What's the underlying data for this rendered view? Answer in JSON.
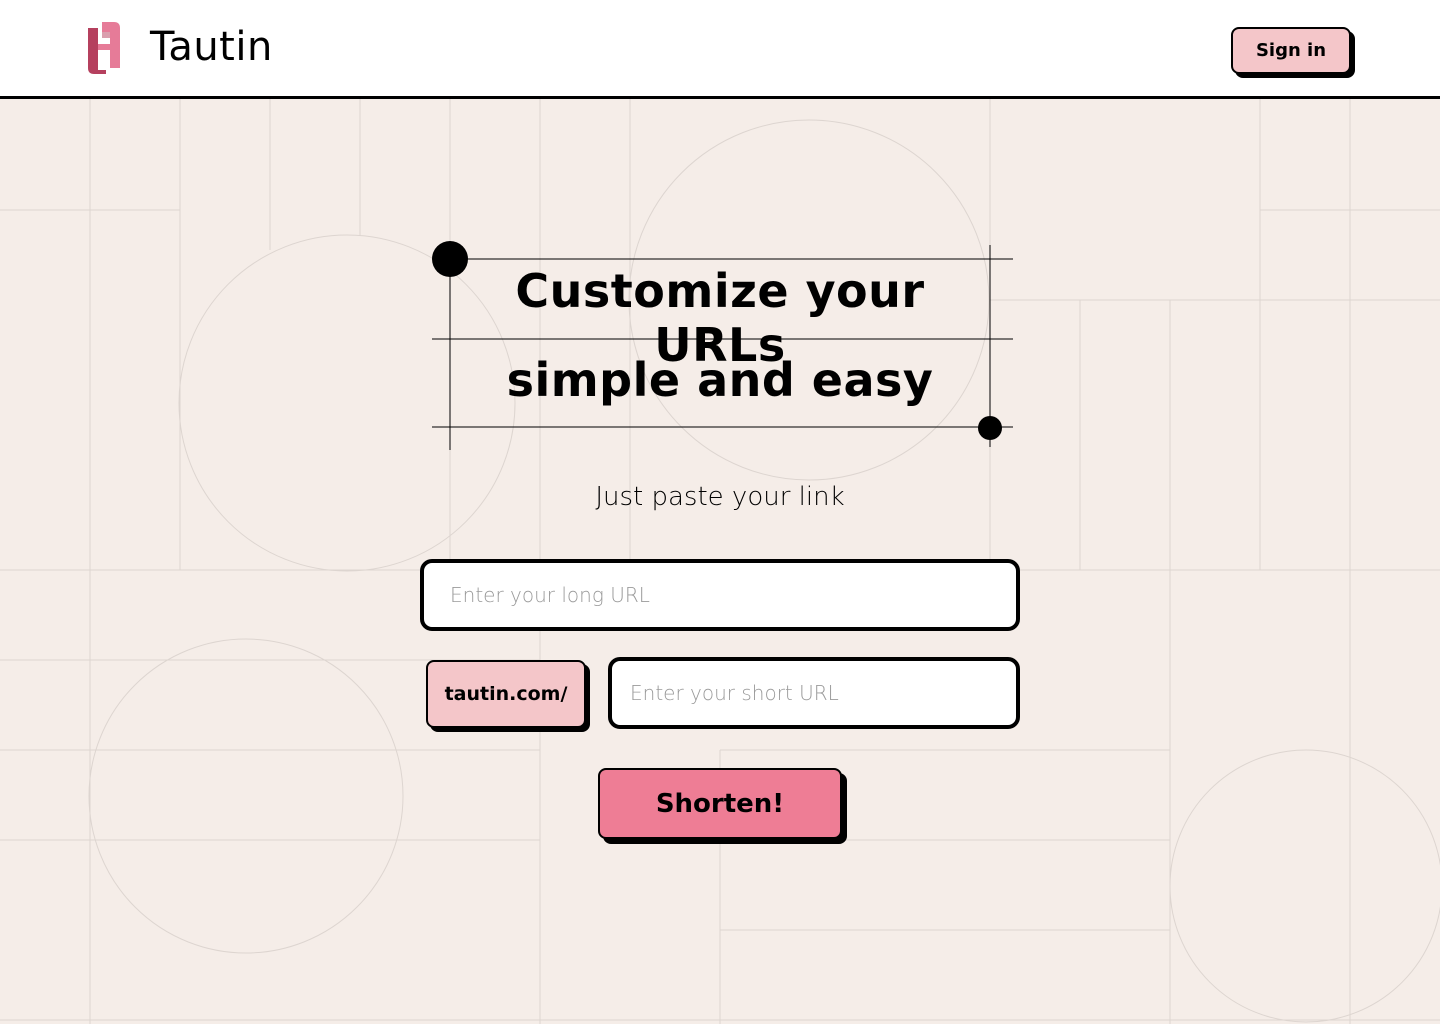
{
  "header": {
    "brand": "Tautin",
    "signin_label": "Sign in",
    "logo_icon": "tautin-logo-icon"
  },
  "hero": {
    "title_line1": "Customize your URLs",
    "title_line2": "simple and easy",
    "subtitle": "Just paste your link"
  },
  "form": {
    "long_url": {
      "value": "",
      "placeholder": "Enter your long URL"
    },
    "prefix": "tautin.com/",
    "short_url": {
      "value": "",
      "placeholder": "Enter your short URL"
    },
    "submit_label": "Shorten!"
  },
  "colors": {
    "background": "#f5ede8",
    "header_bg": "#ffffff",
    "pink_light": "#f4c6c9",
    "pink_accent": "#ee7d95",
    "logo_dark": "#b5405e",
    "logo_light": "#e67b98",
    "grid_line": "#ddd5d0"
  }
}
